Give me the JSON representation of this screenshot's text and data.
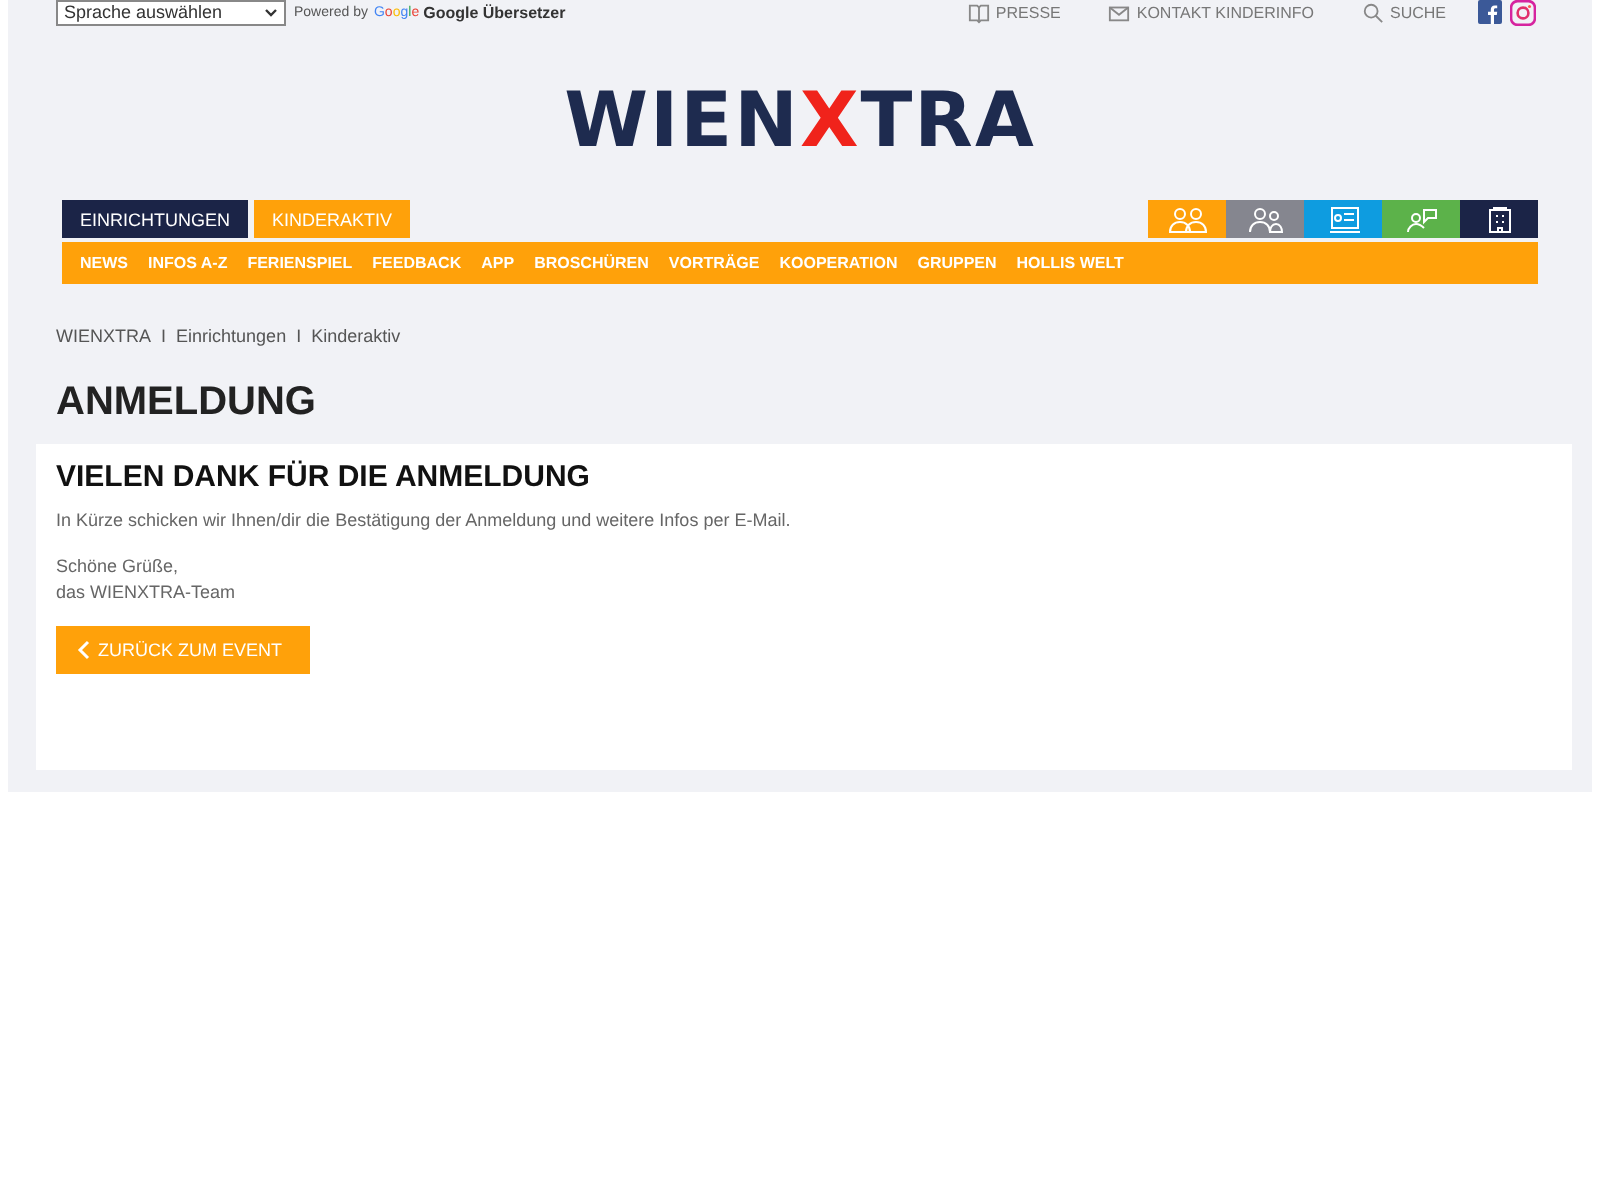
{
  "language_select": {
    "value": "Sprache auswählen"
  },
  "translator": {
    "powered_by": "Powered by",
    "google_logo": "Google",
    "service": "Google Übersetzer"
  },
  "top_links": [
    {
      "label": "PRESSE",
      "kind": "book"
    },
    {
      "label": "KONTAKT KINDERINFO",
      "kind": "mail"
    },
    {
      "label": "SUCHE",
      "kind": "search"
    }
  ],
  "social": [
    {
      "kind": "facebook"
    },
    {
      "kind": "instagram"
    }
  ],
  "logo": {
    "parts": [
      {
        "text": "WIEN",
        "accent": false
      },
      {
        "text": "X",
        "accent": true
      },
      {
        "text": "TRA",
        "accent": false
      }
    ]
  },
  "sections": [
    {
      "label": "EINRICHTUNGEN",
      "color": "#1b2447"
    },
    {
      "label": "KINDERAKTIV",
      "color": "#ffa10a"
    }
  ],
  "audience_tabs": [
    {
      "kind": "parents",
      "color": "#ffa10a"
    },
    {
      "kind": "group",
      "color": "#85868f"
    },
    {
      "kind": "board",
      "color": "#0e9ce0"
    },
    {
      "kind": "speaker",
      "color": "#5cb24a"
    },
    {
      "kind": "building",
      "color": "#1b2447"
    }
  ],
  "menu": [
    "NEWS",
    "INFOS A-Z",
    "FERIENSPIEL",
    "FEEDBACK",
    "APP",
    "BROSCHÜREN",
    "VORTRÄGE",
    "KOOPERATION",
    "GRUPPEN",
    "HOLLIS WELT"
  ],
  "breadcrumb": [
    "WIENXTRA",
    "Einrichtungen",
    "Kinderaktiv"
  ],
  "breadcrumb_separators": [
    "I",
    "I"
  ],
  "page_title": "ANMELDUNG",
  "card": {
    "heading": "VIELEN DANK FÜR DIE ANMELDUNG",
    "message": "In Kürze schicken wir Ihnen/dir die Bestätigung der Anmeldung und weitere Infos per E-Mail.",
    "greeting": "Schöne Grüße,",
    "signature": "das WIENXTRA-Team",
    "button": "ZURÜCK ZUM EVENT"
  }
}
